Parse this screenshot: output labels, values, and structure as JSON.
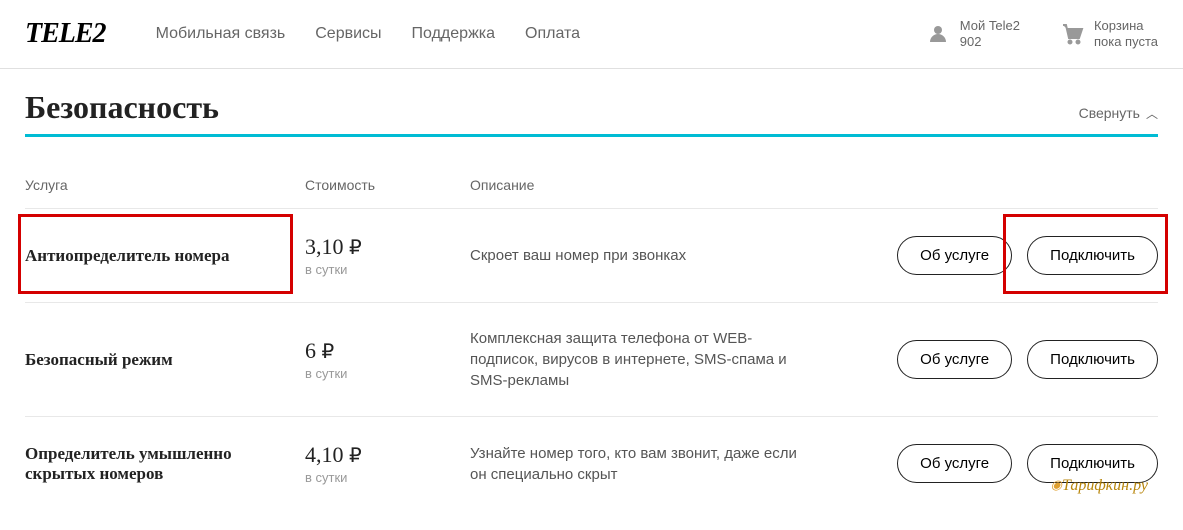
{
  "logo": "TELE2",
  "nav": [
    "Мобильная связь",
    "Сервисы",
    "Поддержка",
    "Оплата"
  ],
  "profile": {
    "label": "Мой Tele2",
    "sub": "902"
  },
  "cart": {
    "label": "Корзина",
    "sub": "пока пуста"
  },
  "section": {
    "title": "Безопасность",
    "collapse": "Свернуть"
  },
  "columns": {
    "name": "Услуга",
    "price": "Стоимость",
    "desc": "Описание"
  },
  "currency": "₽",
  "period": "в сутки",
  "buttons": {
    "about": "Об услуге",
    "connect": "Подключить"
  },
  "services": [
    {
      "name": "Антиопределитель номера",
      "price": "3,10",
      "desc": "Скроет ваш номер при звонках"
    },
    {
      "name": "Безопасный режим",
      "price": "6",
      "desc": "Комплексная защита телефона от WEB-подписок, вирусов в интернете, SMS-спама и SMS-рекламы"
    },
    {
      "name": "Определитель умышленно скрытых номеров",
      "price": "4,10",
      "desc": "Узнайте номер того, кто вам звонит, даже если он специально скрыт"
    }
  ],
  "watermark": "Тарифкин.ру"
}
